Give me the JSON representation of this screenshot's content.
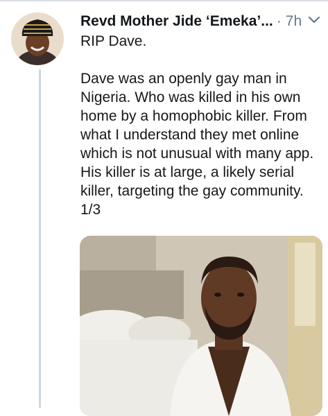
{
  "tweet": {
    "author_name": "Revd Mother Jide ‘Emeka’...",
    "separator": "·",
    "time": "7h",
    "text_line1": "RIP Dave.",
    "text_body": [
      "Dave was an openly gay man in",
      "Nigeria. Who was killed in his own",
      "home by a homophobic killer. From",
      "what I understand they met online",
      "which is not unusual with many app.",
      "His killer is at large, a likely serial",
      "killer, targeting the gay community.",
      "1/3"
    ]
  },
  "icons": {
    "avatar": "avatar-photo",
    "menu": "chevron-down-icon"
  },
  "colors": {
    "text": "#14171a",
    "muted": "#657786",
    "thread": "#ccd6dd"
  }
}
